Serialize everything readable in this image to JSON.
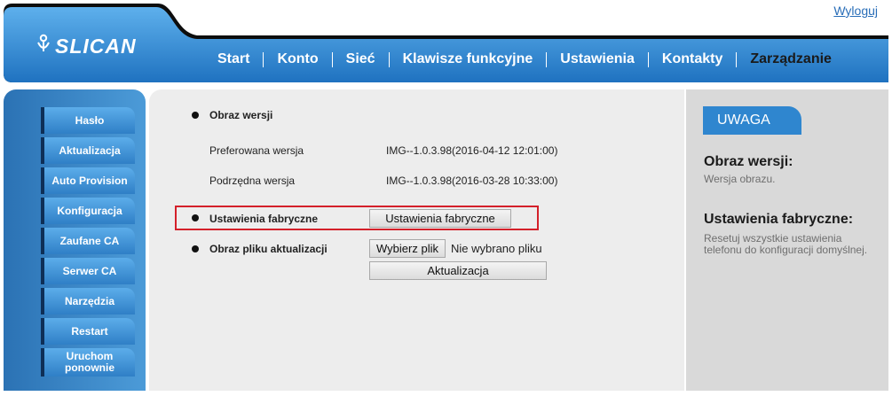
{
  "header": {
    "logout_label": "Wyloguj",
    "logo_text": "SLICAN",
    "nav": [
      {
        "label": "Start"
      },
      {
        "label": "Konto"
      },
      {
        "label": "Sieć"
      },
      {
        "label": "Klawisze funkcyjne"
      },
      {
        "label": "Ustawienia"
      },
      {
        "label": "Kontakty"
      },
      {
        "label": "Zarządzanie",
        "active": true
      }
    ]
  },
  "sidebar": {
    "items": [
      {
        "label": "Hasło"
      },
      {
        "label": "Aktualizacja"
      },
      {
        "label": "Auto Provision"
      },
      {
        "label": "Konfiguracja"
      },
      {
        "label": "Zaufane CA"
      },
      {
        "label": "Serwer CA"
      },
      {
        "label": "Narzędzia"
      },
      {
        "label": "Restart"
      },
      {
        "label": "Uruchom ponownie"
      }
    ]
  },
  "main": {
    "firmware_heading": "Obraz wersji",
    "preferred_label": "Preferowana wersja",
    "preferred_value": "IMG--1.0.3.98(2016-04-12 12:01:00)",
    "secondary_label": "Podrzędna wersja",
    "secondary_value": "IMG--1.0.3.98(2016-03-28 10:33:00)",
    "factory_label": "Ustawienia fabryczne",
    "factory_button": "Ustawienia fabryczne",
    "upgrade_label": "Obraz pliku aktualizacji",
    "choose_file_button": "Wybierz plik",
    "no_file_text": "Nie wybrano pliku",
    "upgrade_button": "Aktualizacja"
  },
  "notes": {
    "badge": "UWAGA",
    "firmware_title": "Obraz wersji:",
    "firmware_text": "Wersja obrazu.",
    "factory_title": "Ustawienia fabryczne:",
    "factory_text": "Resetuj wszystkie ustawienia telefonu do konfiguracji domyślnej."
  },
  "colors": {
    "brand_blue": "#2f86cf",
    "highlight_red": "#d4202a"
  }
}
